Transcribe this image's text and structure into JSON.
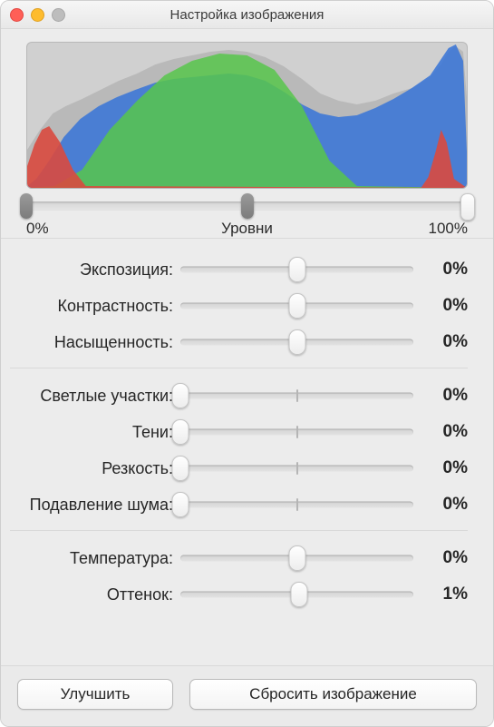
{
  "window": {
    "title": "Настройка изображения"
  },
  "histogram": {
    "levels_label": "Уровни",
    "min_label": "0%",
    "max_label": "100%",
    "black_point": 0,
    "mid_point": 50,
    "white_point": 100
  },
  "groups": [
    {
      "rows": [
        {
          "key": "exposure",
          "label": "Экспозиция:",
          "value": "0%",
          "knob_pct": 50,
          "center_tick": false
        },
        {
          "key": "contrast",
          "label": "Контрастность:",
          "value": "0%",
          "knob_pct": 50,
          "center_tick": false
        },
        {
          "key": "saturation",
          "label": "Насыщенность:",
          "value": "0%",
          "knob_pct": 50,
          "center_tick": false
        }
      ]
    },
    {
      "rows": [
        {
          "key": "highlights",
          "label": "Светлые участки:",
          "value": "0%",
          "knob_pct": 0,
          "center_tick": true
        },
        {
          "key": "shadows",
          "label": "Тени:",
          "value": "0%",
          "knob_pct": 0,
          "center_tick": true
        },
        {
          "key": "sharpness",
          "label": "Резкость:",
          "value": "0%",
          "knob_pct": 0,
          "center_tick": true
        },
        {
          "key": "denoise",
          "label": "Подавление шума:",
          "value": "0%",
          "knob_pct": 0,
          "center_tick": true
        }
      ]
    },
    {
      "rows": [
        {
          "key": "temperature",
          "label": "Температура:",
          "value": "0%",
          "knob_pct": 50,
          "center_tick": false
        },
        {
          "key": "tint",
          "label": "Оттенок:",
          "value": "1%",
          "knob_pct": 51,
          "center_tick": false
        }
      ]
    }
  ],
  "buttons": {
    "enhance": "Улучшить",
    "reset": "Сбросить изображение"
  }
}
